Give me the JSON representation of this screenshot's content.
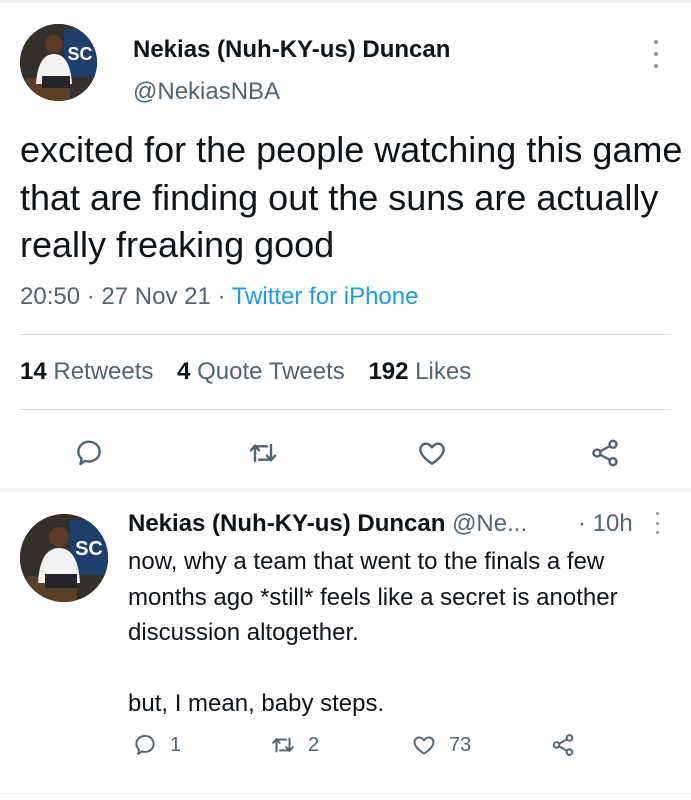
{
  "main_tweet": {
    "author_name": "Nekias (Nuh-KY-us) Duncan",
    "author_handle": "@NekiasNBA",
    "text": "excited for the people watching this game that are finding out the suns are actually really freaking good",
    "time": "20:50",
    "date": "27 Nov 21",
    "sep": "·",
    "source": "Twitter for iPhone",
    "stats": {
      "retweets_count": "14",
      "retweets_label": "Retweets",
      "quotes_count": "4",
      "quotes_label": "Quote Tweets",
      "likes_count": "192",
      "likes_label": "Likes"
    },
    "actions": [
      "reply-icon",
      "retweet-icon",
      "like-icon",
      "share-icon"
    ]
  },
  "reply_tweet": {
    "author_name": "Nekias (Nuh-KY-us) Duncan",
    "author_handle": "@Ne...",
    "time": "· 10h",
    "paragraph_1": "now, why a team that went to the finals a few months ago *still* feels like a secret is another discussion altogether.",
    "paragraph_2": "but, I mean, baby steps.",
    "reply_count": "1",
    "retweet_count": "2",
    "like_count": "73"
  },
  "colors": {
    "text": "#0f1419",
    "secondary": "#536471",
    "link": "#1d9bf0",
    "icon": "#536471"
  }
}
